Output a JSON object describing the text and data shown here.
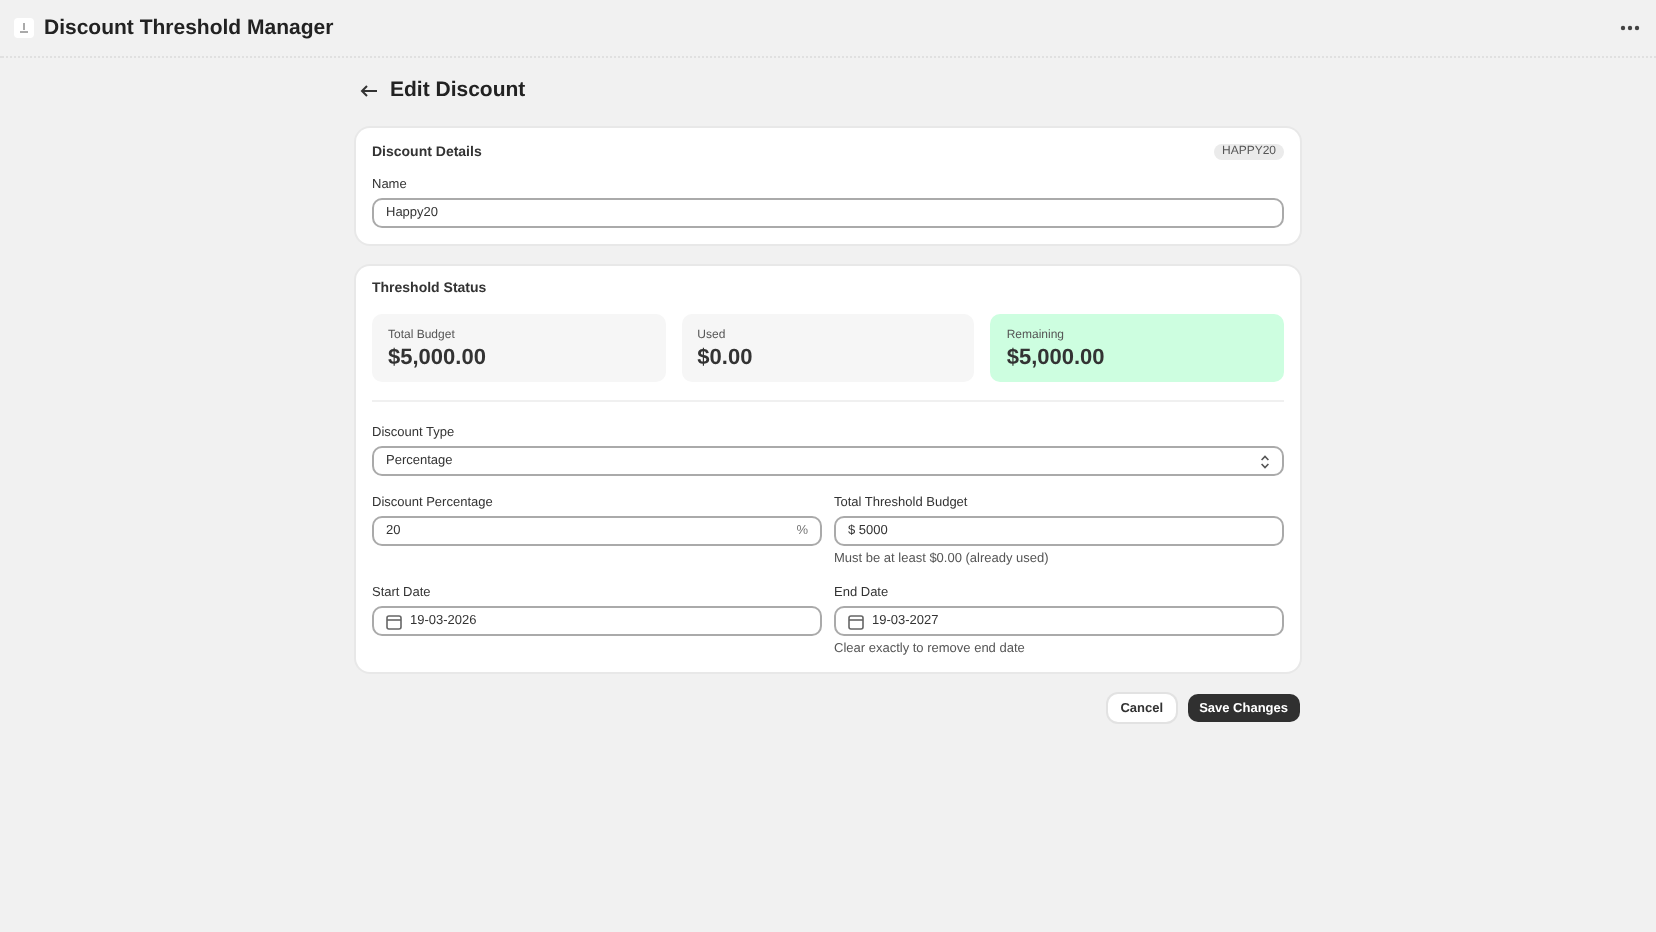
{
  "app": {
    "title": "Discount Threshold Manager"
  },
  "page": {
    "title": "Edit Discount"
  },
  "details": {
    "title": "Discount Details",
    "code": "HAPPY20",
    "name_label": "Name",
    "name_value": "Happy20"
  },
  "threshold": {
    "title": "Threshold Status",
    "stats": [
      {
        "label": "Total Budget",
        "value": "$5,000.00",
        "highlighted": false
      },
      {
        "label": "Used",
        "value": "$0.00",
        "highlighted": false
      },
      {
        "label": "Remaining",
        "value": "$5,000.00",
        "highlighted": true
      }
    ],
    "type_label": "Discount Type",
    "type_value": "Percentage",
    "percent_label": "Discount Percentage",
    "percent_value": "20",
    "percent_suffix": "%",
    "budget_label": "Total Threshold Budget",
    "budget_prefix": "$",
    "budget_value": "5000",
    "budget_hint": "Must be at least $0.00 (already used)",
    "start_label": "Start Date",
    "start_value": "19-03-2026",
    "end_label": "End Date",
    "end_value": "19-03-2027",
    "end_hint": "Clear exactly to remove end date"
  },
  "buttons": {
    "cancel": "Cancel",
    "save": "Save Changes"
  }
}
